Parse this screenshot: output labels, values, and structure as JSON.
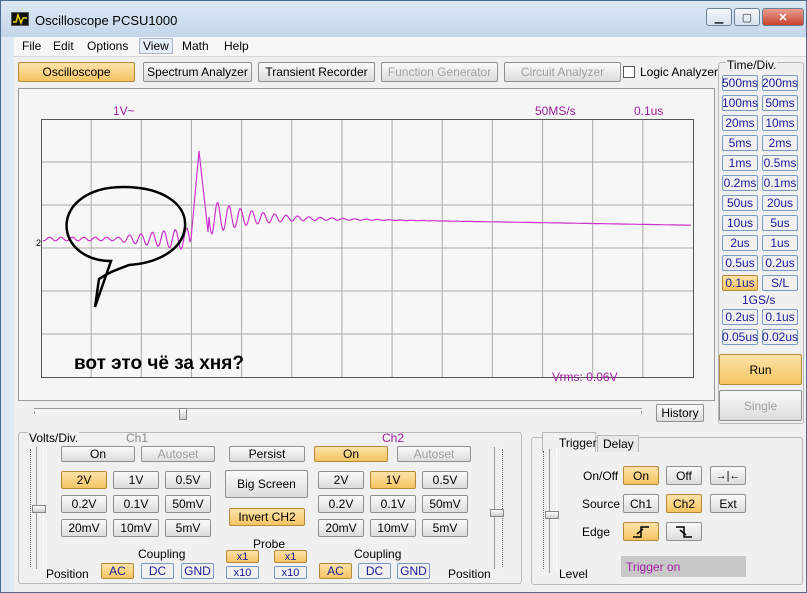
{
  "window": {
    "title": "Oscilloscope PCSU1000"
  },
  "menu": [
    "File",
    "Edit",
    "Options",
    "View",
    "Math",
    "Help"
  ],
  "toolbar": {
    "oscilloscope": "Oscilloscope",
    "spectrum": "Spectrum Analyzer",
    "transient": "Transient Recorder",
    "function_gen": "Function Generator",
    "circuit": "Circuit Analyzer",
    "logic": "Logic Analyzer"
  },
  "scope": {
    "volts_div": "1V~",
    "sample_rate": "50MS/s",
    "time_div_display": "0.1us",
    "ch_marker": "2",
    "vrms": "Vrms: 0.06V",
    "annotation": "вот это чё за хня?",
    "history": "History",
    "trace_color": "#cc33cc",
    "bubble_color": "#000000"
  },
  "timediv": {
    "header": "Time/Div.",
    "buttons": [
      "500ms",
      "200ms",
      "100ms",
      "50ms",
      "20ms",
      "10ms",
      "5ms",
      "2ms",
      "1ms",
      "0.5ms",
      "0.2ms",
      "0.1ms",
      "50us",
      "20us",
      "10us",
      "5us",
      "2us",
      "1us",
      "0.5us",
      "0.2us",
      "0.1us",
      "S/L"
    ],
    "selected": "0.1us",
    "gs_label": "1GS/s",
    "gs_buttons": [
      "0.2us",
      "0.1us",
      "0.05us",
      "0.02us"
    ],
    "run": "Run",
    "single": "Single"
  },
  "volts": {
    "header": "Volts/Div.",
    "ch1": {
      "label": "Ch1",
      "on": "On",
      "autoset": "Autoset",
      "buttons": [
        "2V",
        "1V",
        "0.5V",
        "0.2V",
        "0.1V",
        "50mV",
        "20mV",
        "10mV",
        "5mV"
      ],
      "selected": "2V"
    },
    "ch2": {
      "label": "Ch2",
      "on": "On",
      "autoset": "Autoset",
      "buttons": [
        "2V",
        "1V",
        "0.5V",
        "0.2V",
        "0.1V",
        "50mV",
        "20mV",
        "10mV",
        "5mV"
      ],
      "selected": "1V"
    },
    "persist": "Persist",
    "big_screen": "Big Screen",
    "invert": "Invert CH2",
    "coupling": "Coupling",
    "coupling_opts": [
      "AC",
      "DC",
      "GND"
    ],
    "probe": "Probe",
    "probe_opts": [
      "x1",
      "x10"
    ],
    "position": "Position"
  },
  "trigger": {
    "tab_trigger": "Trigger",
    "tab_delay": "Delay",
    "onoff": "On/Off",
    "on": "On",
    "off": "Off",
    "source": "Source",
    "ch1": "Ch1",
    "ch2": "Ch2",
    "ext": "Ext",
    "edge": "Edge",
    "level": "Level",
    "status": "Trigger on",
    "center_symbol": "→|←"
  }
}
